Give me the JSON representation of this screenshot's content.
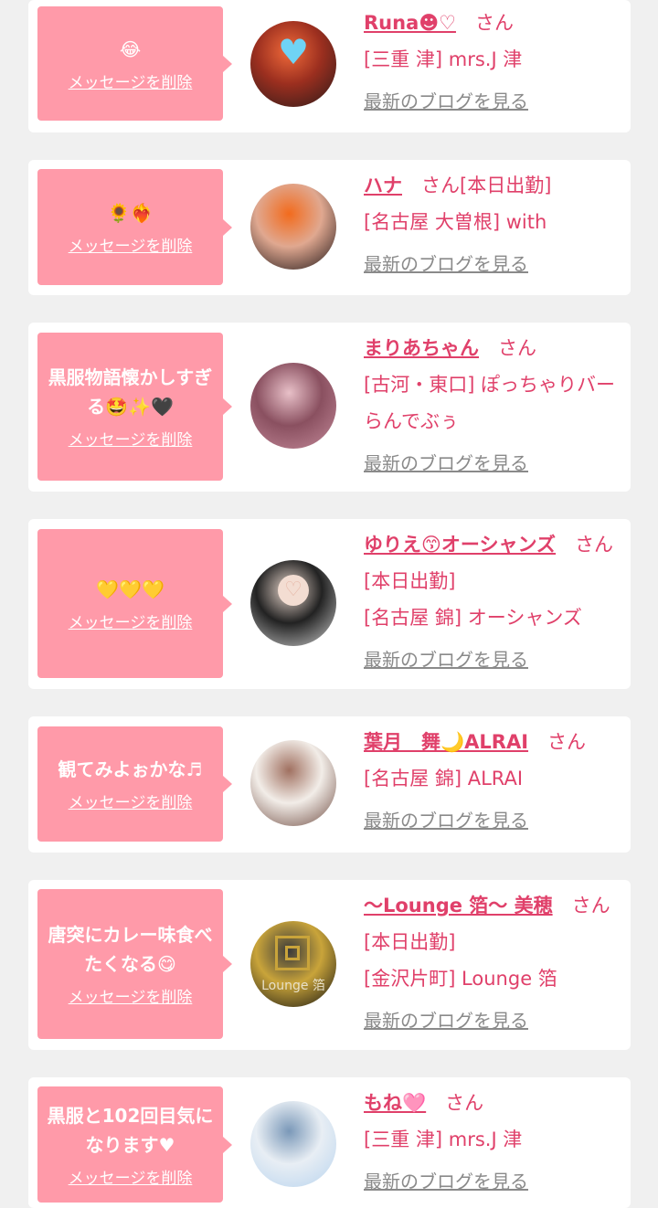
{
  "messages": [
    {
      "message": "😂",
      "delete_label": "メッセージを削除",
      "name": "Runa☻♡",
      "san": "さん",
      "status": "",
      "location": "[三重 津] mrs.J 津",
      "blog_link": "最新のブログを見る",
      "avatar": {
        "colors": [
          "#2a1a1a",
          "#9c2f1f",
          "#f06a3a"
        ],
        "icon": "blue-heart-sticker"
      }
    },
    {
      "message": "🌻❤️‍🔥",
      "delete_label": "メッセージを削除",
      "name": "ハナ",
      "san": "さん",
      "status": "[本日出勤]",
      "location": "[名古屋 大曽根] with",
      "blog_link": "最新のブログを見る",
      "avatar": {
        "colors": [
          "#1d1416",
          "#e0a890",
          "#f26b1d"
        ],
        "icon": ""
      }
    },
    {
      "message": "黒服物語懐かしすぎる🤩✨🖤",
      "delete_label": "メッセージを削除",
      "name": "まりあちゃん",
      "san": "さん",
      "status": "",
      "location": "[古河・東口] ぽっちゃりバー らんでぶぅ",
      "blog_link": "最新のブログを見る",
      "avatar": {
        "colors": [
          "#c48a9a",
          "#8a5060",
          "#e8c0c8"
        ],
        "icon": ""
      }
    },
    {
      "message": "💛💛💛",
      "delete_label": "メッセージを削除",
      "name": "ゆりえ😙オーシャンズ",
      "san": "さん",
      "status": "[本日出勤]",
      "location": "[名古屋 錦] オーシャンズ",
      "blog_link": "最新のブログを見る",
      "avatar": {
        "colors": [
          "#cfcfcf",
          "#222222",
          "#e8d6cc"
        ],
        "icon": "heart-sticker"
      }
    },
    {
      "message": "観てみよぉかな♬",
      "delete_label": "メッセージを削除",
      "name": "葉月　舞🌙ALRAI",
      "san": "さん",
      "status": "",
      "location": "[名古屋 錦] ALRAI",
      "blog_link": "最新のブログを見る",
      "avatar": {
        "colors": [
          "#6e4a40",
          "#f2ede8",
          "#a07060"
        ],
        "icon": ""
      }
    },
    {
      "message": "唐突にカレー味食べたくなる😋",
      "delete_label": "メッセージを削除",
      "name": "〜Lounge 箔〜 美穂",
      "san": "さん",
      "status": "[本日出勤]",
      "location": "[金沢片町] Lounge 箔",
      "blog_link": "最新のブログを見る",
      "avatar": {
        "colors": [
          "#111111",
          "#c9a43a",
          "#3a3a3a"
        ],
        "icon": "lounge-logo",
        "logo_text": "Lounge 箔"
      }
    },
    {
      "message": "黒服と102回目気になります♥",
      "delete_label": "メッセージを削除",
      "name": "もね🩷",
      "san": "さん",
      "status": "",
      "location": "[三重 津] mrs.J 津",
      "blog_link": "最新のブログを見る",
      "avatar": {
        "colors": [
          "#b7d3ee",
          "#e8eef4",
          "#7a98b8"
        ],
        "icon": ""
      }
    }
  ]
}
